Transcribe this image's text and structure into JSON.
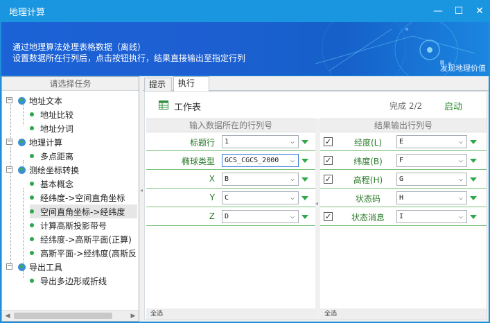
{
  "window": {
    "title": "地理计算"
  },
  "window_controls": {
    "minimize": "—",
    "maximize": "☐",
    "close": "✕"
  },
  "banner": {
    "line1": "通过地理算法处理表格数据（离线）",
    "line2": "设置数据所在行列后，点击按钮执行，结果直接输出至指定行列",
    "slogan": "发现地理价值"
  },
  "task_panel": {
    "header": "请选择任务",
    "groups": [
      {
        "label": "地址文本",
        "items": [
          "地址比较",
          "地址分词"
        ]
      },
      {
        "label": "地理计算",
        "items": [
          "多点距离"
        ]
      },
      {
        "label": "测绘坐标转换",
        "items": [
          "基本概念",
          "经纬度->空间直角坐标",
          "空间直角坐标->经纬度",
          "计算高斯投影带号",
          "经纬度->高斯平面(正算)",
          "高斯平面->经纬度(高斯反"
        ]
      },
      {
        "label": "导出工具",
        "items": [
          "导出多边形或折线"
        ]
      }
    ],
    "selected": "空间直角坐标->经纬度"
  },
  "tabs": [
    {
      "label": "提示"
    },
    {
      "label": "执行"
    }
  ],
  "active_tab": "执行",
  "toolbar": {
    "worksheet_label": "工作表",
    "status": "完成 2/2",
    "start_label": "启动"
  },
  "input_panel": {
    "header": "输入数据所在的行列号",
    "rows": [
      {
        "label": "标题行",
        "value": "1"
      },
      {
        "label": "椭球类型",
        "value": "GCS_CGCS_2000"
      },
      {
        "label": "X",
        "value": "B"
      },
      {
        "label": "Y",
        "value": "C"
      },
      {
        "label": "Z",
        "value": "D"
      }
    ],
    "footer": "全选"
  },
  "output_panel": {
    "header": "结果输出行列号",
    "rows": [
      {
        "label": "经度(L)",
        "value": "E",
        "checked": true
      },
      {
        "label": "纬度(B)",
        "value": "F",
        "checked": true
      },
      {
        "label": "高程(H)",
        "value": "G",
        "checked": true
      },
      {
        "label": "状态码",
        "value": "H",
        "checked": false
      },
      {
        "label": "状态消息",
        "value": "I",
        "checked": true
      }
    ],
    "footer": "全选"
  },
  "colors": {
    "titlebar": "#1a95e0",
    "banner": "#1b62d6",
    "accent_green": "#2fa84a",
    "row_border": "#7ac07a"
  }
}
